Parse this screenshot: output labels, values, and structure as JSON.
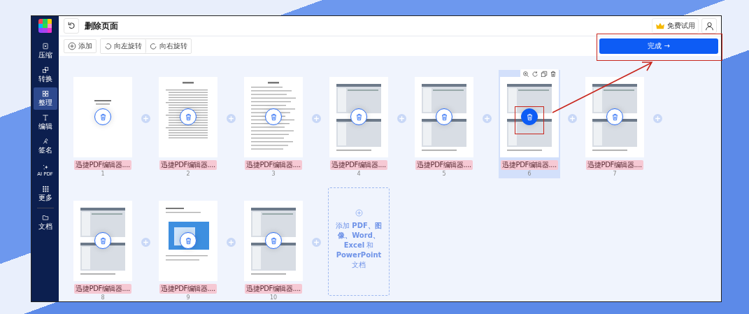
{
  "sidebar": {
    "items": [
      {
        "label": "压缩",
        "selected": false
      },
      {
        "label": "转换",
        "selected": false
      },
      {
        "label": "整理",
        "selected": true
      },
      {
        "label": "编辑",
        "selected": false
      },
      {
        "label": "签名",
        "selected": false
      },
      {
        "label": "AI PDF",
        "selected": false
      },
      {
        "label": "更多",
        "selected": false
      }
    ],
    "bottom_items": [
      {
        "label": "文档"
      }
    ]
  },
  "header": {
    "title": "删除页面",
    "trial": "免费试用"
  },
  "toolbar": {
    "add": "添加",
    "rotate_left": "向左旋转",
    "rotate_right": "向右旋转",
    "done": "完成 →"
  },
  "rows": [
    [
      {
        "kind": "title",
        "name": "迅捷PDF编辑器....",
        "number": "1",
        "selected": false
      },
      {
        "kind": "toc",
        "name": "迅捷PDF编辑器....",
        "number": "2",
        "selected": false
      },
      {
        "kind": "text",
        "name": "迅捷PDF编辑器....",
        "number": "3",
        "selected": false
      },
      {
        "kind": "screens",
        "name": "迅捷PDF编辑器....",
        "number": "4",
        "selected": false
      },
      {
        "kind": "screens",
        "name": "迅捷PDF编辑器....",
        "number": "5",
        "selected": false
      },
      {
        "kind": "screens",
        "name": "迅捷PDF编辑器....",
        "number": "6",
        "selected": true
      },
      {
        "kind": "screens",
        "name": "迅捷PDF编辑器....",
        "number": "7",
        "selected": false
      }
    ],
    [
      {
        "kind": "screens",
        "name": "迅捷PDF编辑器....",
        "number": "8",
        "selected": false
      },
      {
        "kind": "mixed",
        "name": "迅捷PDF编辑器....",
        "number": "9",
        "selected": false
      },
      {
        "kind": "screens",
        "name": "迅捷PDF编辑器....",
        "number": "10",
        "selected": false
      }
    ]
  ],
  "add_files": {
    "text": "添加 **PDF、图像、Word、Excel** 和 **PowerPoint** 文档"
  }
}
